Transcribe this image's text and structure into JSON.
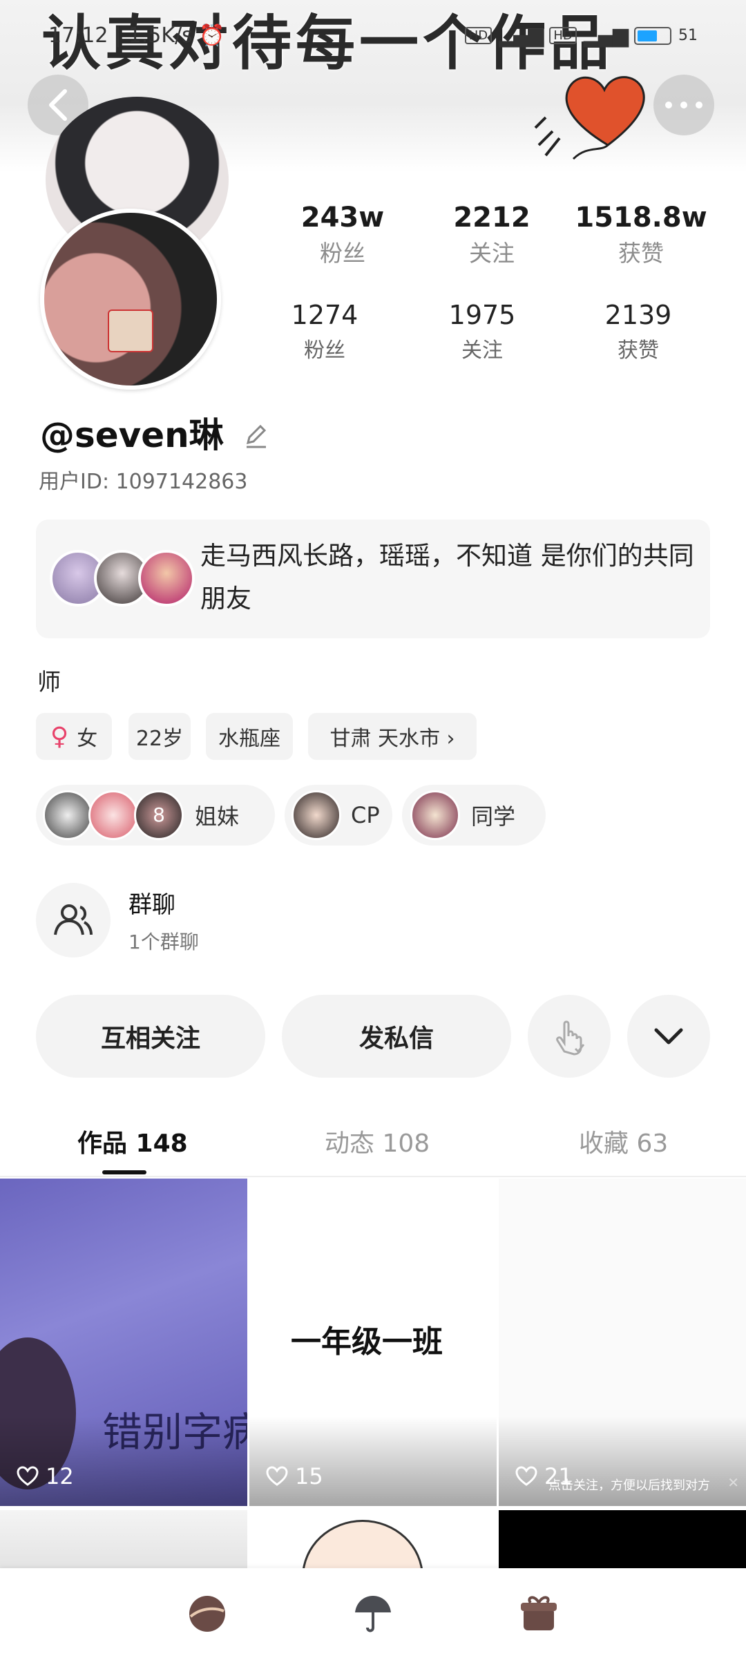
{
  "banner": {
    "text": "认真对待每一个作品"
  },
  "status_bar": {
    "time": "17:12",
    "speed": "1.5K/s",
    "network_badge_1": "HD",
    "network_badge_2": "HD",
    "battery": "51"
  },
  "header": {
    "back_icon": "chevron-left-icon",
    "more_icon": "more-horizontal-icon"
  },
  "stats_primary": [
    {
      "value": "243w",
      "label": "粉丝"
    },
    {
      "value": "2212",
      "label": "关注"
    },
    {
      "value": "1518.8w",
      "label": "获赞"
    }
  ],
  "stats_secondary": [
    {
      "value": "1274",
      "label": "粉丝"
    },
    {
      "value": "1975",
      "label": "关注"
    },
    {
      "value": "2139",
      "label": "获赞"
    }
  ],
  "profile": {
    "username": "@seven琳",
    "user_id": "用户ID: 1097142863",
    "bio": "师"
  },
  "friends_card": {
    "text": "走马西风长路，瑶瑶，不知道 是你们的共同朋友"
  },
  "tags": [
    {
      "label": "女",
      "icon": "female-icon",
      "icon_color": "#e8436b"
    },
    {
      "label": "22岁"
    },
    {
      "label": "水瓶座"
    },
    {
      "label": "甘肃 天水市 ›"
    }
  ],
  "relations": [
    {
      "count": "8",
      "label": "姐妹"
    },
    {
      "label": "CP"
    },
    {
      "label": "同学"
    }
  ],
  "group_chat": {
    "title": "群聊",
    "subtitle": "1个群聊"
  },
  "actions": {
    "follow_each_other": "互相关注",
    "message": "发私信"
  },
  "tabs": [
    {
      "label": "作品 148",
      "active": true
    },
    {
      "label": "动态 108",
      "active": false
    },
    {
      "label": "收藏 63",
      "active": false
    }
  ],
  "works": [
    {
      "likes": "12",
      "overlay_text": "错别字病"
    },
    {
      "likes": "15",
      "overlay_text": "一年级一班"
    },
    {
      "likes": "21",
      "overlay_text": "点击关注，方便以后找到对方"
    }
  ],
  "colors": {
    "background": "#ffffff",
    "heart": "#e0522c",
    "muted": "#8c8c8c"
  }
}
